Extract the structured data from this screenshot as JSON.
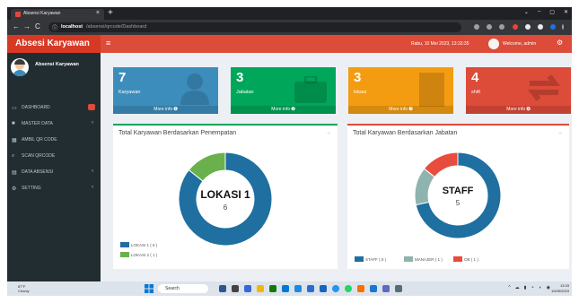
{
  "browser": {
    "tab_title": "Absensi Karyawan",
    "tab_close": "×",
    "new_tab": "+",
    "window_controls": [
      "⌄",
      "–",
      "▢",
      "✕"
    ],
    "nav_back": "←",
    "nav_forward": "→",
    "nav_reload": "C",
    "url_icon": "ⓘ",
    "url_host": "localhost",
    "url_path": "/absensi/qrcode/Dashboard"
  },
  "app": {
    "brand": "Absesi Karyawan",
    "menu_toggle": "≡",
    "datetime": "Rabu, 10 Mei 2023, 13:33:35",
    "welcome": "Welcome, admin",
    "settings_icon": "⚙"
  },
  "sidebar": {
    "user_name": "Absensi Karyawan",
    "items": [
      {
        "label": "DASHBOARD",
        "icon": "▭"
      },
      {
        "label": "MASTER DATA",
        "icon": "■"
      },
      {
        "label": "AMBIL QR CODE",
        "icon": "▦"
      },
      {
        "label": "SCAN QRCODE",
        "icon": "⌕"
      },
      {
        "label": "DATA ABSENSI",
        "icon": "▤"
      },
      {
        "label": "SETTING",
        "icon": "⚙"
      }
    ],
    "arrow": "‹"
  },
  "stat_boxes": [
    {
      "value": "7",
      "label": "Karyawan",
      "footer": "More info ➊",
      "color": "#3c8dbc"
    },
    {
      "value": "3",
      "label": "Jabatan",
      "footer": "More info ➋",
      "color": "#00a65a"
    },
    {
      "value": "3",
      "label": "lokasi",
      "footer": "More info ➌",
      "color": "#f39c12"
    },
    {
      "value": "4",
      "label": "shift",
      "footer": "More info ➍",
      "color": "#dd4b39"
    }
  ],
  "panels": [
    {
      "title": "Total Karyawan Berdasarkan Penempatan",
      "center_label": "LOKASI 1",
      "center_value": "6",
      "minimize": "–"
    },
    {
      "title": "Total Karyawan Berdasarkan Jabatan",
      "center_label": "STAFF",
      "center_value": "5",
      "minimize": "–"
    }
  ],
  "chart_data": [
    {
      "type": "pie",
      "title": "Total Karyawan Berdasarkan Penempatan",
      "categories": [
        "LOKASI 1",
        "LOKASI 2"
      ],
      "values": [
        6,
        1
      ],
      "legend_labels": [
        "LOKASI 1 ( 6 )",
        "LOKASI 2 ( 1 )"
      ],
      "colors": [
        "#1f6fa0",
        "#6ab04c"
      ]
    },
    {
      "type": "pie",
      "title": "Total Karyawan Berdasarkan Jabatan",
      "categories": [
        "STAFF",
        "MANAJER",
        "OB"
      ],
      "values": [
        5,
        1,
        1
      ],
      "legend_labels": [
        "STAFF ( 5 )",
        "MANAJER ( 1 )",
        "OB ( 1 )"
      ],
      "colors": [
        "#1f6fa0",
        "#8fb3ae",
        "#e74c3c"
      ]
    }
  ],
  "taskbar": {
    "weather_temp": "87°F",
    "weather_desc": "Cloudy",
    "search_label": "Search",
    "tray_icons": [
      "^",
      "☁",
      "▮",
      "⚬",
      "◐",
      "◉"
    ],
    "time": "13:33",
    "date": "10/05/2023"
  }
}
